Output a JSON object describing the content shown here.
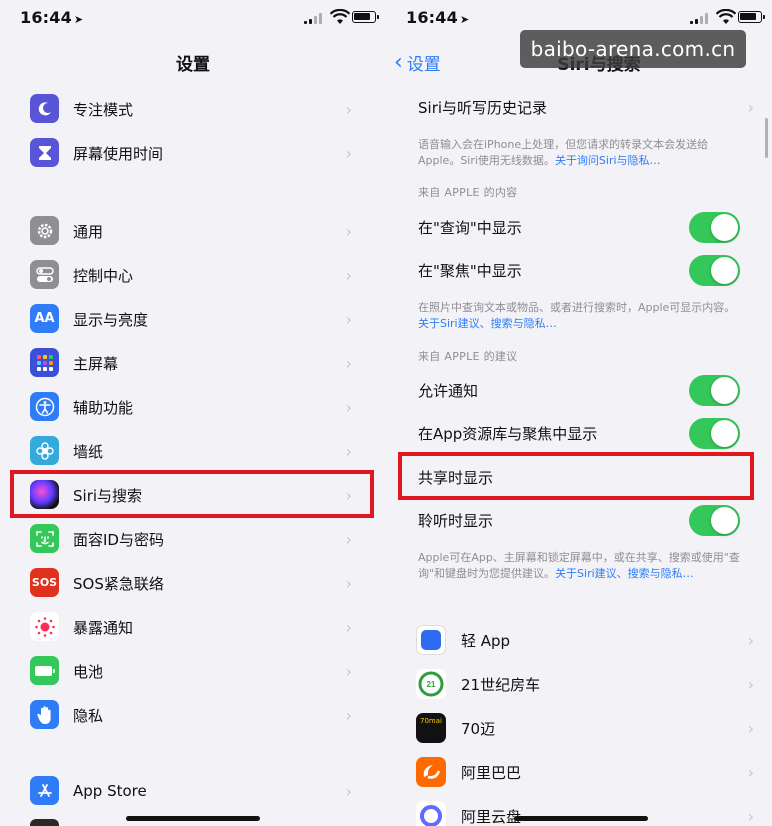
{
  "left": {
    "status_time": "16:44",
    "title": "设置",
    "rows": [
      {
        "label": "专注模式",
        "color": "#5856d6",
        "icon": "moon-icon"
      },
      {
        "label": "屏幕使用时间",
        "color": "#5856d6",
        "icon": "hourglass-icon"
      },
      {
        "label": "通用",
        "color": "#8e8e93",
        "icon": "gear-icon"
      },
      {
        "label": "控制中心",
        "color": "#8e8e93",
        "icon": "switches-icon"
      },
      {
        "label": "显示与亮度",
        "color": "#2f7cf6",
        "icon": "text-size-icon",
        "glyph": "AA"
      },
      {
        "label": "主屏幕",
        "color": "#3a50d9",
        "icon": "home-grid-icon"
      },
      {
        "label": "辅助功能",
        "color": "#2f7cf6",
        "icon": "accessibility-icon"
      },
      {
        "label": "墙纸",
        "color": "#34aadc",
        "icon": "flower-icon"
      },
      {
        "label": "Siri与搜索",
        "color": "#222",
        "icon": "siri-icon"
      },
      {
        "label": "面容ID与密码",
        "color": "#34c759",
        "icon": "face-id-icon"
      },
      {
        "label": "SOS紧急联络",
        "color": "#e0301e",
        "icon": "sos-icon",
        "glyph": "SOS"
      },
      {
        "label": "暴露通知",
        "color": "#fff",
        "icon": "exposure-icon"
      },
      {
        "label": "电池",
        "color": "#34c759",
        "icon": "battery-icon"
      },
      {
        "label": "隐私",
        "color": "#2f7cf6",
        "icon": "hand-icon"
      },
      {
        "label": "App Store",
        "color": "#2f7cf6",
        "icon": "app-store-icon"
      }
    ]
  },
  "right": {
    "status_time": "16:44",
    "back_label": "设置",
    "title": "Siri与搜索",
    "history_label": "Siri与听写历史记录",
    "note1_text": "语音输入会在iPhone上处理，但您请求的转录文本会发送给Apple。Siri使用无线数据。",
    "note1_link": "关于询问Siri与隐私…",
    "section1": "来自 APPLE 的内容",
    "toggle_row1": "在\"查询\"中显示",
    "toggle_row2": "在\"聚焦\"中显示",
    "note2_text": "在照片中查询文本或物品、或者进行搜索时，Apple可显示内容。",
    "note2_link": "关于Siri建议、搜索与隐私…",
    "section2": "来自 APPLE 的建议",
    "toggle_row3": "允许通知",
    "toggle_row4": "在App资源库与聚焦中显示",
    "share_row": "共享时显示",
    "toggle_row5": "聆听时显示",
    "note3_text": "Apple可在App、主屏幕和锁定屏幕中，或在共享、搜索或使用\"查询\"和键盘时为您提供建议。",
    "note3_link": "关于Siri建议、搜索与隐私…",
    "apps": [
      {
        "label": "轻 App",
        "color": "#2f6bf0",
        "icon": "qing-app-icon"
      },
      {
        "label": "21世纪房车",
        "color": "#fff",
        "icon": "rv-21-icon"
      },
      {
        "label": "70迈",
        "color": "#111",
        "icon": "70mai-icon",
        "glyph": "70mai"
      },
      {
        "label": "阿里巴巴",
        "color": "#ff6a00",
        "icon": "alibaba-icon"
      },
      {
        "label": "阿里云盘",
        "color": "#fff",
        "icon": "aliyun-drive-icon"
      }
    ]
  },
  "watermark": "baibo-arena.com.cn"
}
